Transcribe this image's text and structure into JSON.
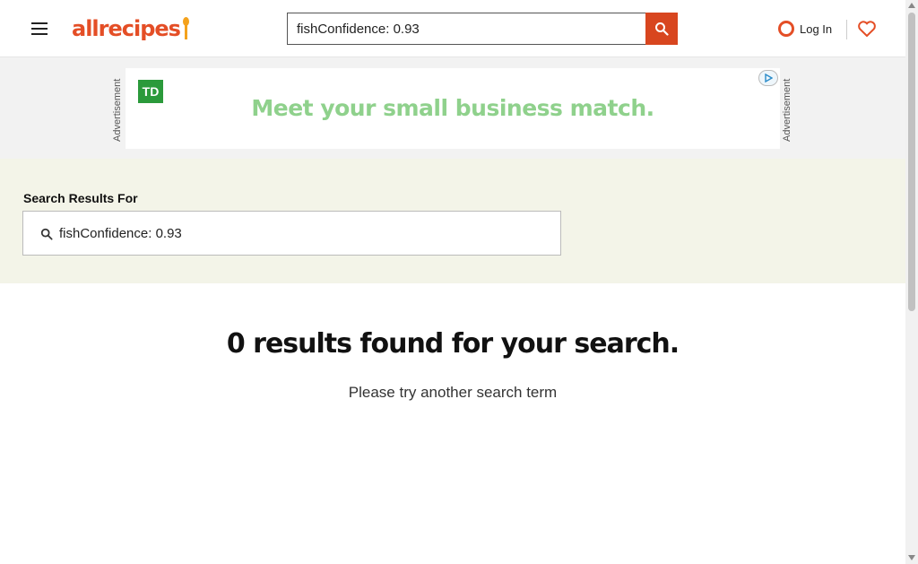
{
  "header": {
    "logo_text": "allrecipes",
    "search_value": "fishConfidence: 0.93",
    "login_label": "Log In"
  },
  "ad": {
    "side_label": "Advertisement",
    "brand": "TD",
    "headline": "Meet your small business match."
  },
  "results": {
    "heading": "Search Results For",
    "query": "fishConfidence: 0.93"
  },
  "main": {
    "no_results": "0 results found for your search.",
    "suggestion": "Please try another search term"
  },
  "colors": {
    "brand": "#e44e26",
    "search_button": "#d8461f",
    "ad_green": "#8fd18c",
    "results_band": "#f3f4e8"
  },
  "icons": {
    "menu": "hamburger-icon",
    "search": "search-icon",
    "login": "user-circle-icon",
    "saved": "heart-icon",
    "field": "search-icon",
    "adchoices": "adchoices-icon"
  }
}
